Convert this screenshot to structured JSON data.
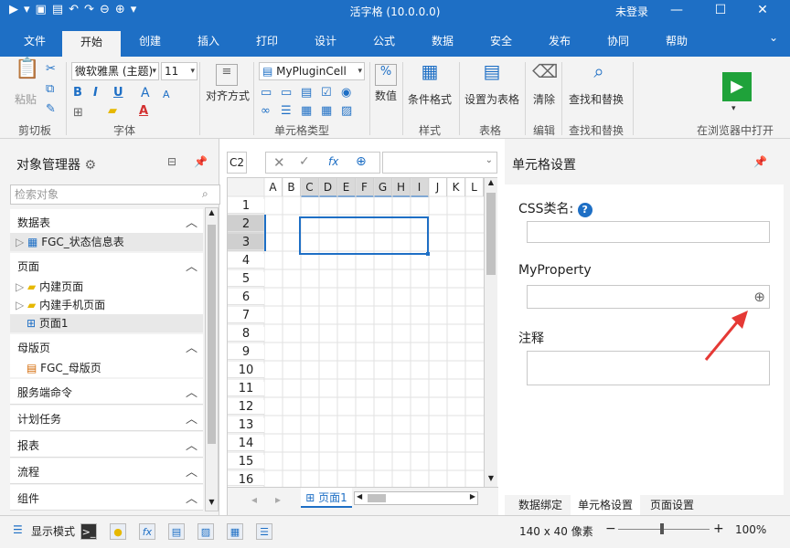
{
  "titlebar": {
    "title": "活字格 (10.0.0.0)",
    "login": "未登录",
    "minimize": "—",
    "maximize": "☐",
    "close": "✕",
    "quick_icons": [
      "▶",
      "▾",
      "💾",
      "📂",
      "↶",
      "↷",
      "⊖",
      "⊕",
      "▾"
    ]
  },
  "menu": {
    "tabs": [
      "文件",
      "开始",
      "创建",
      "插入",
      "打印",
      "设计",
      "公式",
      "数据",
      "安全",
      "发布",
      "协同",
      "帮助"
    ],
    "active": "开始",
    "collapse": "⌄"
  },
  "ribbon": {
    "clipboard": {
      "paste": "粘贴",
      "label": "剪切板"
    },
    "font": {
      "family": "微软雅黑 (主题)",
      "size": "11",
      "label": "字体",
      "bold": "B",
      "italic": "I",
      "underline": "U",
      "grow": "A",
      "shrink": "A"
    },
    "align": {
      "label": "对齐方式"
    },
    "celltype": {
      "selected": "MyPluginCell",
      "label": "单元格类型"
    },
    "number": {
      "label": "数值",
      "icon": "%"
    },
    "cond_format": {
      "label": "条件格式"
    },
    "style_label": "样式",
    "table": {
      "label": "设置为表格",
      "group": "表格"
    },
    "edit": {
      "label": "清除",
      "group": "编辑"
    },
    "findreplace": {
      "label": "查找和替换",
      "group": "查找和替换"
    },
    "browser": {
      "label": "在浏览器中打开"
    }
  },
  "object_manager": {
    "title": "对象管理器",
    "search_placeholder": "检索对象",
    "sections": [
      {
        "label": "数据表",
        "items": [
          "FGC_状态信息表"
        ]
      },
      {
        "label": "页面",
        "items": [
          "内建页面",
          "内建手机页面",
          "页面1"
        ]
      },
      {
        "label": "母版页",
        "items": [
          "FGC_母版页"
        ]
      },
      {
        "label": "服务端命令",
        "items": []
      },
      {
        "label": "计划任务",
        "items": []
      },
      {
        "label": "报表",
        "items": []
      },
      {
        "label": "流程",
        "items": []
      },
      {
        "label": "组件",
        "items": []
      }
    ]
  },
  "sheet": {
    "cell_ref": "C2",
    "fx": "fx",
    "columns": [
      "A",
      "B",
      "C",
      "D",
      "E",
      "F",
      "G",
      "H",
      "I",
      "J",
      "K",
      "L"
    ],
    "rows": [
      "1",
      "2",
      "3",
      "4",
      "5",
      "6",
      "7",
      "8",
      "9",
      "10",
      "11",
      "12",
      "13",
      "14",
      "15",
      "16"
    ],
    "tab_label": "页面1"
  },
  "cell_settings": {
    "title": "单元格设置",
    "css_label": "CSS类名:",
    "help": "?",
    "my_property_label": "MyProperty",
    "note_label": "注释",
    "bottom_tabs": [
      "数据绑定",
      "单元格设置",
      "页面设置"
    ],
    "active_tab": "单元格设置"
  },
  "statusbar": {
    "display_mode": "显示模式",
    "size": "140 x 40 像素",
    "zoom": "100%",
    "zoom_minus": "−",
    "zoom_plus": "+"
  },
  "colors": {
    "accent": "#1e6fc5",
    "arrow": "#e53935",
    "run_green": "#1fa23a"
  }
}
